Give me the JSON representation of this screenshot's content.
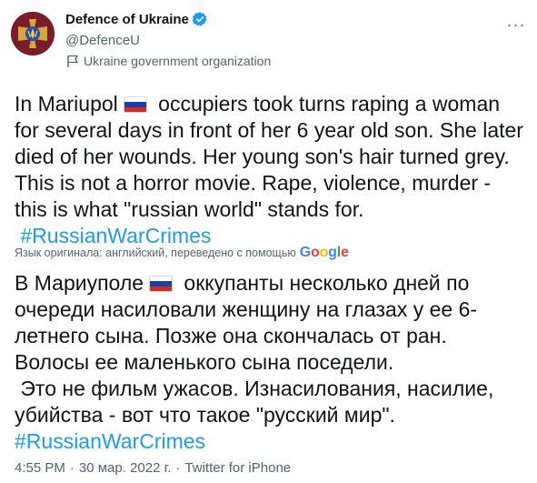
{
  "author": {
    "name": "Defence of Ukraine",
    "handle": "@DefenceU",
    "label": "Ukraine government organization"
  },
  "tweet": {
    "en_part1": "In Mariupol",
    "en_part2": " occupiers took turns raping a woman for several days in front of her 6 year old son. She later died of her wounds. Her young son's hair turned grey. This is not a horror movie. Rape, violence, murder - this is what \"russian world\" stands for.",
    "en_hashtag": "#RussianWarCrimes",
    "translation_note": "Язык оригинала: английский, переведено с помощью",
    "translation_brand": "Google",
    "ru_part1": "В Мариуполе",
    "ru_part2": " оккупанты несколько дней по очереди насиловали женщину на глазах у ее 6-летнего сына. Позже она скончалась от ран. Волосы ее маленького сына поседели.\n Это не фильм ужасов. Изнасилования, насилие, убийства - вот что такое \"русский мир\".",
    "ru_hashtag": "#RussianWarCrimes"
  },
  "meta": {
    "time": "4:55 PM",
    "separator": "·",
    "date": "30 мар. 2022 г.",
    "source": "Twitter for iPhone"
  },
  "more_label": "···",
  "colors": {
    "link": "#1d9bf0",
    "secondary": "#536471",
    "verified": "#1d9bf0",
    "flag": [
      "#ffffff",
      "#1c3fa8",
      "#d52b1e"
    ]
  },
  "icons": [
    "avatar-emblem-icon",
    "verified-badge-icon",
    "government-flag-icon",
    "more-options-icon",
    "russian-flag-icon"
  ]
}
